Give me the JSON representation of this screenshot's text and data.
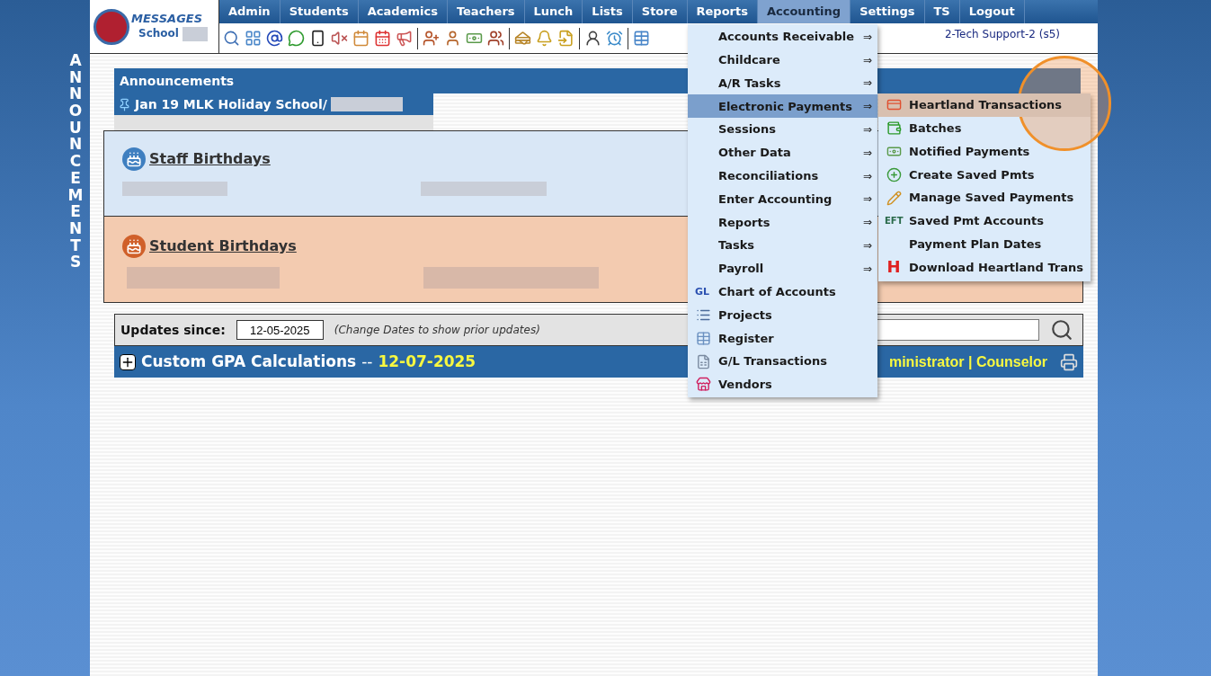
{
  "side_label": "ANNOUNCEMENTS",
  "logo": {
    "brand": "MESSAGES",
    "school": "School"
  },
  "nav": [
    {
      "label": "Admin",
      "selected": false
    },
    {
      "label": "Students",
      "selected": false
    },
    {
      "label": "Academics",
      "selected": false
    },
    {
      "label": "Teachers",
      "selected": false
    },
    {
      "label": "Lunch",
      "selected": false
    },
    {
      "label": "Lists",
      "selected": false
    },
    {
      "label": "Store",
      "selected": false
    },
    {
      "label": "Reports",
      "selected": false
    },
    {
      "label": "Accounting",
      "selected": true
    },
    {
      "label": "Settings",
      "selected": false
    },
    {
      "label": "TS",
      "selected": false
    },
    {
      "label": "Logout",
      "selected": false
    }
  ],
  "user": "2-Tech Support-2 (s5)",
  "announcements": {
    "title": "Announcements",
    "items": [
      "Jan 19 MLK Holiday School/"
    ]
  },
  "staff_birthdays": {
    "title": "Staff Birthdays"
  },
  "student_birthdays": {
    "title": "Student Birthdays"
  },
  "updates": {
    "label": "Updates since:",
    "date": "12-05-2025",
    "hint": "(Change Dates to show prior updates)"
  },
  "gpa_row": {
    "title": "Custom GPA Calculations",
    "separator": "--",
    "date": "12-07-2025",
    "roles": "ministrator | Counselor"
  },
  "accounting_menu": [
    {
      "label": "Accounts Receivable",
      "kind": "submenu",
      "arrow": "⇒",
      "selected": false
    },
    {
      "label": "Childcare",
      "kind": "submenu",
      "arrow": "⇒",
      "selected": false
    },
    {
      "label": "A/R Tasks",
      "kind": "submenu",
      "arrow": "⇒",
      "selected": false
    },
    {
      "label": "Electronic Payments",
      "kind": "submenu",
      "arrow": "⇒",
      "selected": true
    },
    {
      "label": "Sessions",
      "kind": "submenu",
      "arrow": "⇒",
      "selected": false
    },
    {
      "label": "Other Data",
      "kind": "submenu",
      "arrow": "⇒",
      "selected": false
    },
    {
      "label": "Reconciliations",
      "kind": "submenu",
      "arrow": "⇒",
      "selected": false
    },
    {
      "label": "Enter Accounting",
      "kind": "submenu",
      "arrow": "⇒",
      "selected": false
    },
    {
      "label": "Reports",
      "kind": "submenu",
      "arrow": "⇒",
      "selected": false
    },
    {
      "label": "Tasks",
      "kind": "submenu",
      "arrow": "⇒",
      "selected": false
    },
    {
      "label": "Payroll",
      "kind": "submenu",
      "arrow": "⇒",
      "selected": false
    },
    {
      "label": "Chart of Accounts",
      "kind": "link",
      "icon_text": "GL",
      "selected": false
    },
    {
      "label": "Projects",
      "kind": "link",
      "selected": false
    },
    {
      "label": "Register",
      "kind": "link",
      "selected": false
    },
    {
      "label": "G/L Transactions",
      "kind": "link",
      "selected": false
    },
    {
      "label": "Vendors",
      "kind": "link",
      "selected": false
    }
  ],
  "payments_submenu": [
    {
      "label": "Heartland Transactions",
      "selected": true
    },
    {
      "label": "Batches",
      "selected": false
    },
    {
      "label": "Notified Payments",
      "selected": false
    },
    {
      "label": "Create Saved Pmts",
      "selected": false
    },
    {
      "label": "Manage Saved Payments",
      "selected": false
    },
    {
      "label": "Saved Pmt Accounts",
      "icon_text": "EFT",
      "selected": false
    },
    {
      "label": "Payment Plan Dates",
      "selected": false
    },
    {
      "label": "Download Heartland Trans",
      "icon_text": "H",
      "selected": false
    }
  ]
}
